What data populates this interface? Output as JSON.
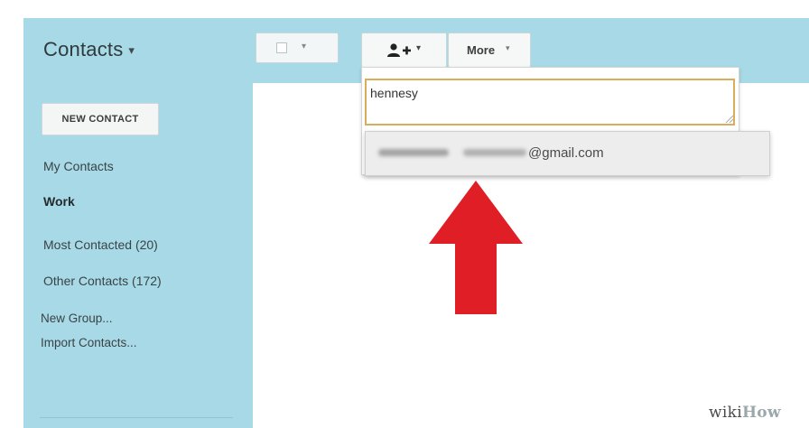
{
  "header": {
    "app_title": "Contacts",
    "app_title_caret": "▾",
    "select_caret": "▾",
    "add_contact_caret": "▾",
    "more_label": "More",
    "more_caret": "▾"
  },
  "add_contact_dropdown": {
    "input_value": "hennesy",
    "suggestion": {
      "email_domain": "@gmail.com"
    }
  },
  "sidebar": {
    "new_contact_label": "NEW CONTACT",
    "items": [
      {
        "label": "My Contacts",
        "bold": false
      },
      {
        "label": "Work",
        "bold": true
      },
      {
        "label": "Most Contacted (20)",
        "bold": false
      },
      {
        "label": "Other Contacts (172)",
        "bold": false
      }
    ],
    "links": [
      {
        "label": "New Group..."
      },
      {
        "label": "Import Contacts..."
      }
    ]
  },
  "icons": {
    "add_person": "add-person-icon",
    "arrow": "red-up-arrow-icon"
  },
  "colors": {
    "sidebar_bg": "#a8d9e6",
    "input_border": "#d8ae5a",
    "arrow": "#e01e26"
  },
  "watermark": {
    "part1": "wiki",
    "part2": "How"
  }
}
